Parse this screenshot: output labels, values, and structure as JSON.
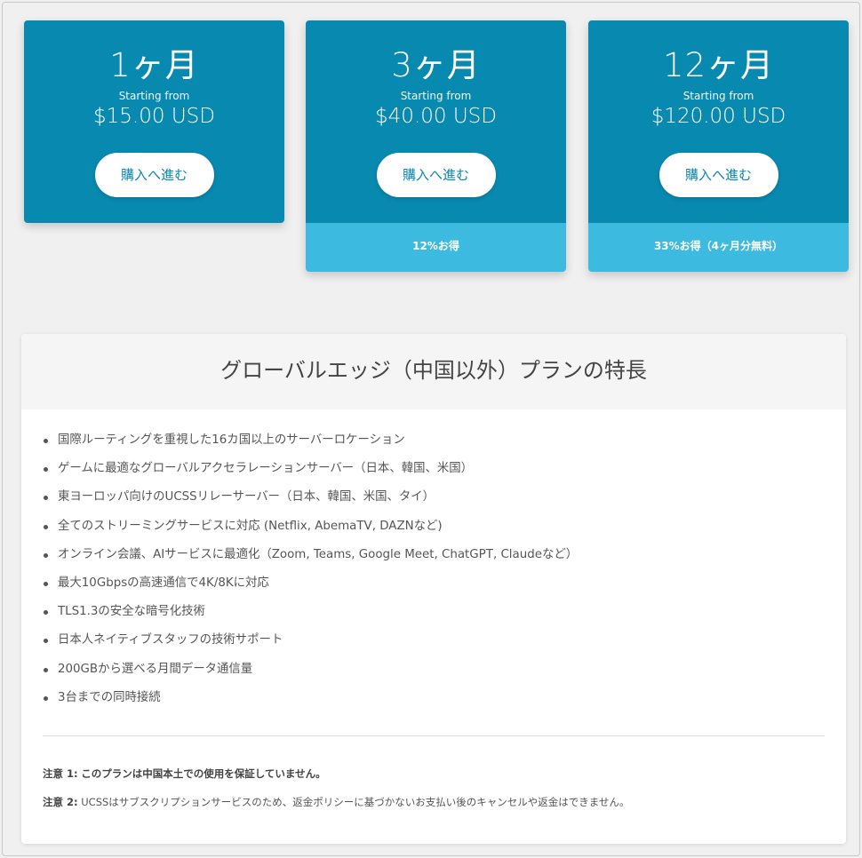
{
  "plans": [
    {
      "period": "1ヶ月",
      "starting": "Starting from",
      "price": "$15.00 USD",
      "button": "購入へ進む",
      "saving": ""
    },
    {
      "period": "3ヶ月",
      "starting": "Starting from",
      "price": "$40.00 USD",
      "button": "購入へ進む",
      "saving": "12%お得"
    },
    {
      "period": "12ヶ月",
      "starting": "Starting from",
      "price": "$120.00 USD",
      "button": "購入へ進む",
      "saving": "33%お得（4ヶ月分無料）"
    }
  ],
  "features": {
    "title": "グローバルエッジ（中国以外）プランの特長",
    "items": [
      "国際ルーティングを重視した16カ国以上のサーバーロケーション",
      "ゲームに最適なグローバルアクセラレーションサーバー（日本、韓国、米国）",
      "東ヨーロッパ向けのUCSSリレーサーバー（日本、韓国、米国、タイ）",
      "全てのストリーミングサービスに対応 (Netflix, AbemaTV, DAZNなど)",
      "オンライン会議、AIサービスに最適化（Zoom, Teams, Google Meet, ChatGPT, Claudeなど）",
      "最大10Gbpsの高速通信で4K/8Kに対応",
      "TLS1.3の安全な暗号化技術",
      "日本人ネイティブスタッフの技術サポート",
      "200GBから選べる月間データ通信量",
      "3台までの同時接続"
    ],
    "notes": [
      {
        "label": "注意 1:",
        "text": "このプランは中国本土での使用を保証していません。",
        "bold": true
      },
      {
        "label": "注意 2:",
        "text": "UCSSはサブスクリプションサービスのため、返金ポリシーに基づかないお支払い後のキャンセルや返金はできません。",
        "bold": false
      }
    ]
  },
  "colors": {
    "plan_head": "#0889b0",
    "plan_saving": "#3dbadf",
    "button_text": "#0a86ad"
  }
}
